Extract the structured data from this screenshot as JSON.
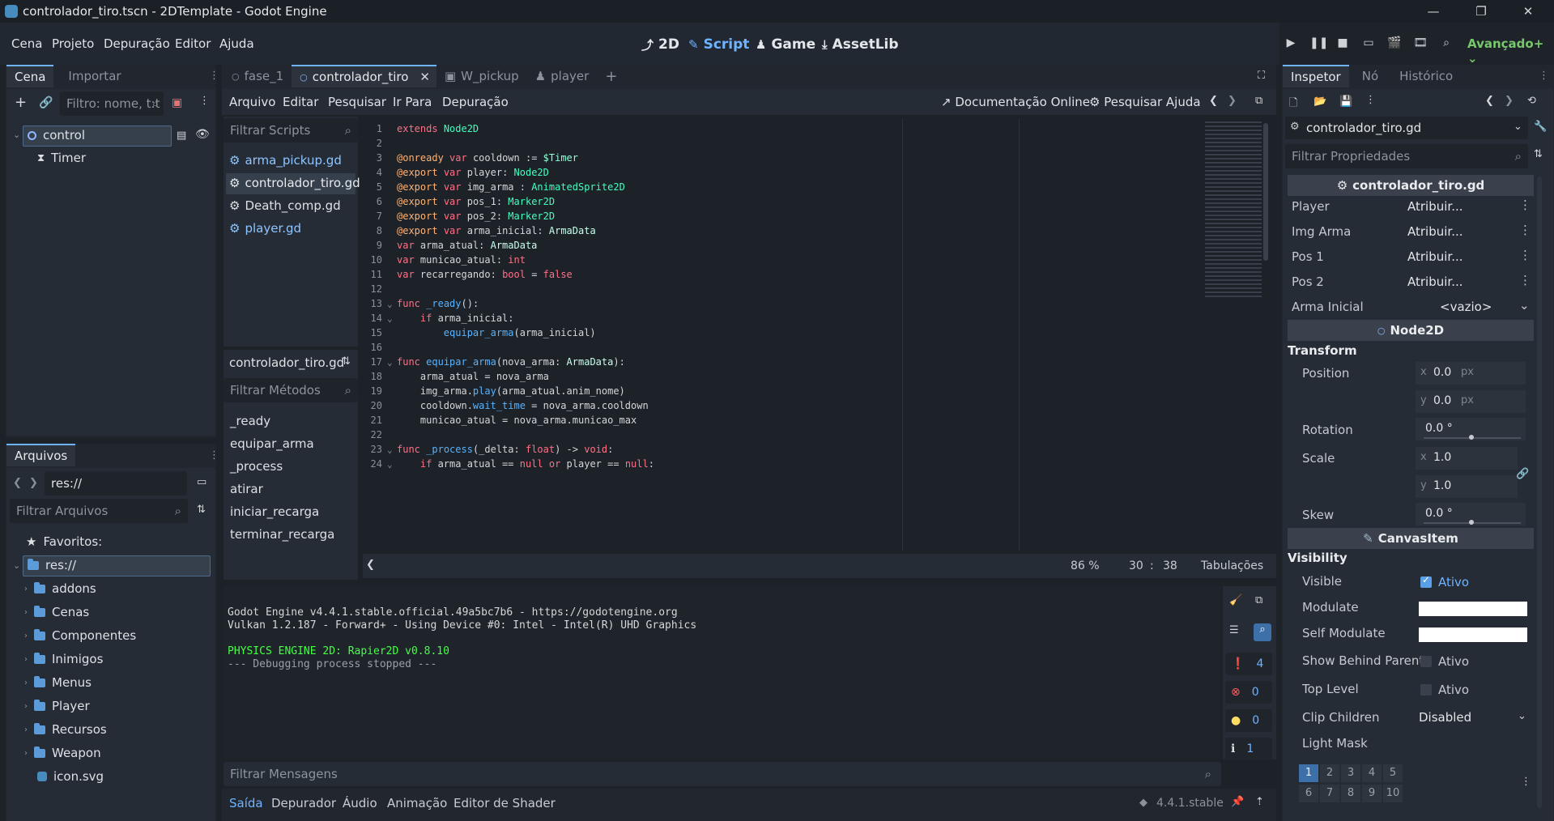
{
  "window": {
    "title": "controlador_tiro.tscn - 2DTemplate - Godot Engine"
  },
  "menu": [
    "Cena",
    "Projeto",
    "Depuração",
    "Editor",
    "Ajuda"
  ],
  "main_screens": [
    {
      "label": "2D"
    },
    {
      "label": "Script",
      "active": true
    },
    {
      "label": "Game"
    },
    {
      "label": "AssetLib"
    }
  ],
  "renderer": "Avançado+",
  "scene_dock": {
    "tabs": [
      "Cena",
      "Importar"
    ],
    "filter_placeholder": "Filtro: nome, t:t",
    "nodes": [
      {
        "name": "control",
        "icon": "control-node-icon"
      },
      {
        "name": "Timer",
        "icon": "timer-icon"
      }
    ]
  },
  "files_dock": {
    "tab": "Arquivos",
    "path": "res://",
    "filter_placeholder": "Filtrar Arquivos",
    "favorites": "Favoritos:",
    "root": "res://",
    "folders": [
      "addons",
      "Cenas",
      "Componentes",
      "Inimigos",
      "Menus",
      "Player",
      "Recursos",
      "Weapon"
    ],
    "files": [
      "icon.svg"
    ]
  },
  "editor_tabs": [
    "fase_1",
    "controlador_tiro",
    "W_pickup",
    "player"
  ],
  "script_menu": [
    "Arquivo",
    "Editar",
    "Pesquisar",
    "Ir Para",
    "Depuração"
  ],
  "script_links": [
    "Documentação Online",
    "Pesquisar Ajuda"
  ],
  "script_list": {
    "filter_placeholder": "Filtrar Scripts",
    "scripts": [
      "arma_pickup.gd",
      "controlador_tiro.gd",
      "Death_comp.gd",
      "player.gd"
    ],
    "current": "controlador_tiro.gd",
    "methods_filter_placeholder": "Filtrar Métodos",
    "methods": [
      "_ready",
      "equipar_arma",
      "_process",
      "atirar",
      "iniciar_recarga",
      "terminar_recarga"
    ]
  },
  "code_lines": [
    "1",
    "2",
    "3",
    "4",
    "5",
    "6",
    "7",
    "8",
    "9",
    "10",
    "11",
    "12",
    "13",
    "14",
    "15",
    "16",
    "17",
    "18",
    "19",
    "20",
    "21",
    "22",
    "23",
    "24"
  ],
  "code_text": [
    "extends Node2D",
    "",
    "@onready var cooldown := $Timer",
    "@export var player: Node2D",
    "@export var img_arma : AnimatedSprite2D",
    "@export var pos_1: Marker2D",
    "@export var pos_2: Marker2D",
    "@export var arma_inicial: ArmaData",
    "var arma_atual: ArmaData",
    "var municao_atual: int",
    "var recarregando: bool = false",
    "",
    "func _ready():",
    "    if arma_inicial:",
    "        equipar_arma(arma_inicial)",
    "",
    "func equipar_arma(nova_arma: ArmaData):",
    "    arma_atual = nova_arma",
    "    img_arma.play(arma_atual.anim_nome)",
    "    cooldown.wait_time = nova_arma.cooldown",
    "    municao_atual = nova_arma.municao_max",
    "",
    "func _process(_delta: float) -> void:",
    "    if arma_atual == null or player == null:"
  ],
  "status_bar": {
    "zoom": "86 %",
    "line": "30",
    "col": "38",
    "indent": "Tabulações"
  },
  "output": {
    "lines": [
      "Godot Engine v4.4.1.stable.official.49a5bc7b6 - https://godotengine.org",
      "Vulkan 1.2.187 - Forward+ - Using Device #0: Intel - Intel(R) UHD Graphics",
      "",
      "PHYSICS ENGINE 2D: Rapier2D v0.8.10",
      "--- Debugging process stopped ---"
    ],
    "filter_placeholder": "Filtrar Mensagens",
    "counts": {
      "messages": "4",
      "errors": "0",
      "warnings": "0",
      "info": "1"
    }
  },
  "bottom_tabs": [
    "Saída",
    "Depurador",
    "Áudio",
    "Animação",
    "Editor de Shader"
  ],
  "version": "4.4.1.stable",
  "inspector": {
    "tabs": [
      "Inspetor",
      "Nó",
      "Histórico"
    ],
    "resource": "controlador_tiro.gd",
    "filter_placeholder": "Filtrar Propriedades",
    "script_section": "controlador_tiro.gd",
    "props": [
      {
        "label": "Player",
        "value": "Atribuir..."
      },
      {
        "label": "Img Arma",
        "value": "Atribuir..."
      },
      {
        "label": "Pos 1",
        "value": "Atribuir..."
      },
      {
        "label": "Pos 2",
        "value": "Atribuir..."
      },
      {
        "label": "Arma Inicial",
        "value": "<vazio>"
      }
    ],
    "node2d_section": "Node2D",
    "transform": {
      "label": "Transform",
      "position": {
        "label": "Position",
        "x": "0.0",
        "y": "0.0",
        "unit": "px"
      },
      "rotation": {
        "label": "Rotation",
        "value": "0.0 °"
      },
      "scale": {
        "label": "Scale",
        "x": "1.0",
        "y": "1.0"
      },
      "skew": {
        "label": "Skew",
        "value": "0.0 °"
      }
    },
    "canvas_section": "CanvasItem",
    "visibility": {
      "label": "Visibility",
      "visible": {
        "label": "Visible",
        "value": "Ativo",
        "checked": true
      },
      "modulate": "Modulate",
      "self_modulate": "Self Modulate",
      "show_behind": {
        "label": "Show Behind Parent",
        "value": "Ativo",
        "checked": false
      },
      "top_level": {
        "label": "Top Level",
        "value": "Ativo",
        "checked": false
      },
      "clip_children": {
        "label": "Clip Children",
        "value": "Disabled"
      },
      "light_mask": {
        "label": "Light Mask",
        "layers": [
          "1",
          "2",
          "3",
          "4",
          "5",
          "6",
          "7",
          "8",
          "9",
          "10"
        ]
      }
    }
  },
  "colors": {
    "accent": "#6fb3ff",
    "keyword": "#ff7085",
    "type": "#42ffc2",
    "function": "#57b3ff",
    "annotation": "#ffb373",
    "error": "#ff5d5d",
    "warning": "#ffdd65",
    "output_green": "#44ff44"
  }
}
